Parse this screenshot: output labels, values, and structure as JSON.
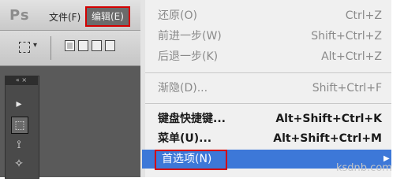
{
  "app": {
    "logo": "Ps"
  },
  "menubar": {
    "file": "文件(F)",
    "edit": "编辑(E)"
  },
  "edit_menu": {
    "items": [
      {
        "label": "还原(O)",
        "shortcut": "Ctrl+Z"
      },
      {
        "label": "前进一步(W)",
        "shortcut": "Shift+Ctrl+Z"
      },
      {
        "label": "后退一步(K)",
        "shortcut": "Alt+Ctrl+Z"
      },
      {
        "label": "渐隐(D)...",
        "shortcut": "Shift+Ctrl+F"
      },
      {
        "label": "键盘快捷键...",
        "shortcut": "Alt+Shift+Ctrl+K"
      },
      {
        "label": "菜单(U)...",
        "shortcut": "Alt+Shift+Ctrl+M"
      },
      {
        "label": "首选项(N)",
        "shortcut": ""
      }
    ],
    "highlight_color": "#3d78d8",
    "annotation_color": "#d40000"
  },
  "tools": {
    "header": "« ×"
  },
  "watermark": "ksdnb.com"
}
